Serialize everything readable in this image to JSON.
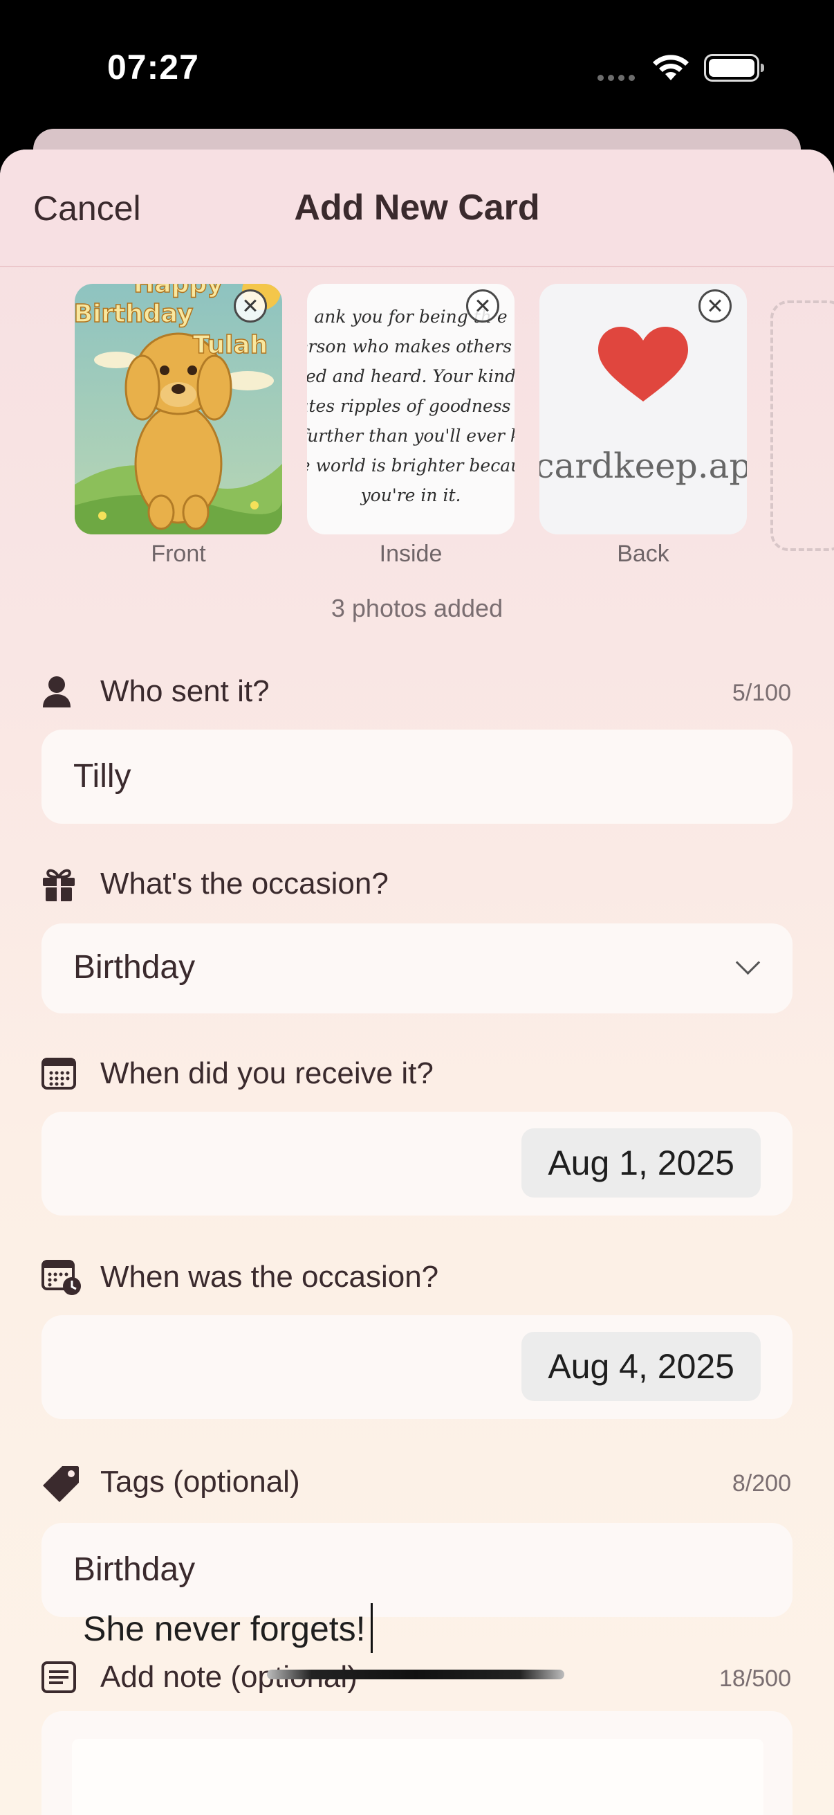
{
  "status": {
    "time": "07:27"
  },
  "header": {
    "cancel": "Cancel",
    "title": "Add New Card"
  },
  "photos": {
    "items": [
      {
        "label": "Front",
        "lines": [
          "Happy",
          "Birthday",
          "Tulah"
        ]
      },
      {
        "label": "Inside",
        "lines": [
          "ank you for being th  e",
          "erson who makes others f",
          "ed and heard. Your kind",
          "ates ripples of goodness t",
          "further than you'll ever k",
          "e world is brighter becau",
          "you're in it."
        ]
      },
      {
        "label": "Back",
        "lines": [
          "cardkeep.ap"
        ]
      }
    ],
    "count_text": "3 photos added"
  },
  "form": {
    "sender": {
      "label": "Who sent it?",
      "count": "5/100",
      "value": "Tilly"
    },
    "occasion": {
      "label": "What's the occasion?",
      "value": "Birthday"
    },
    "received": {
      "label": "When did you receive it?",
      "value": "Aug 1, 2025"
    },
    "occasion_date": {
      "label": "When was the occasion?",
      "value": "Aug 4, 2025"
    },
    "tags": {
      "label": "Tags (optional)",
      "count": "8/200",
      "value": "Birthday"
    },
    "note": {
      "label": "Add note (optional)",
      "count": "18/500",
      "value": "She never forgets!"
    }
  }
}
